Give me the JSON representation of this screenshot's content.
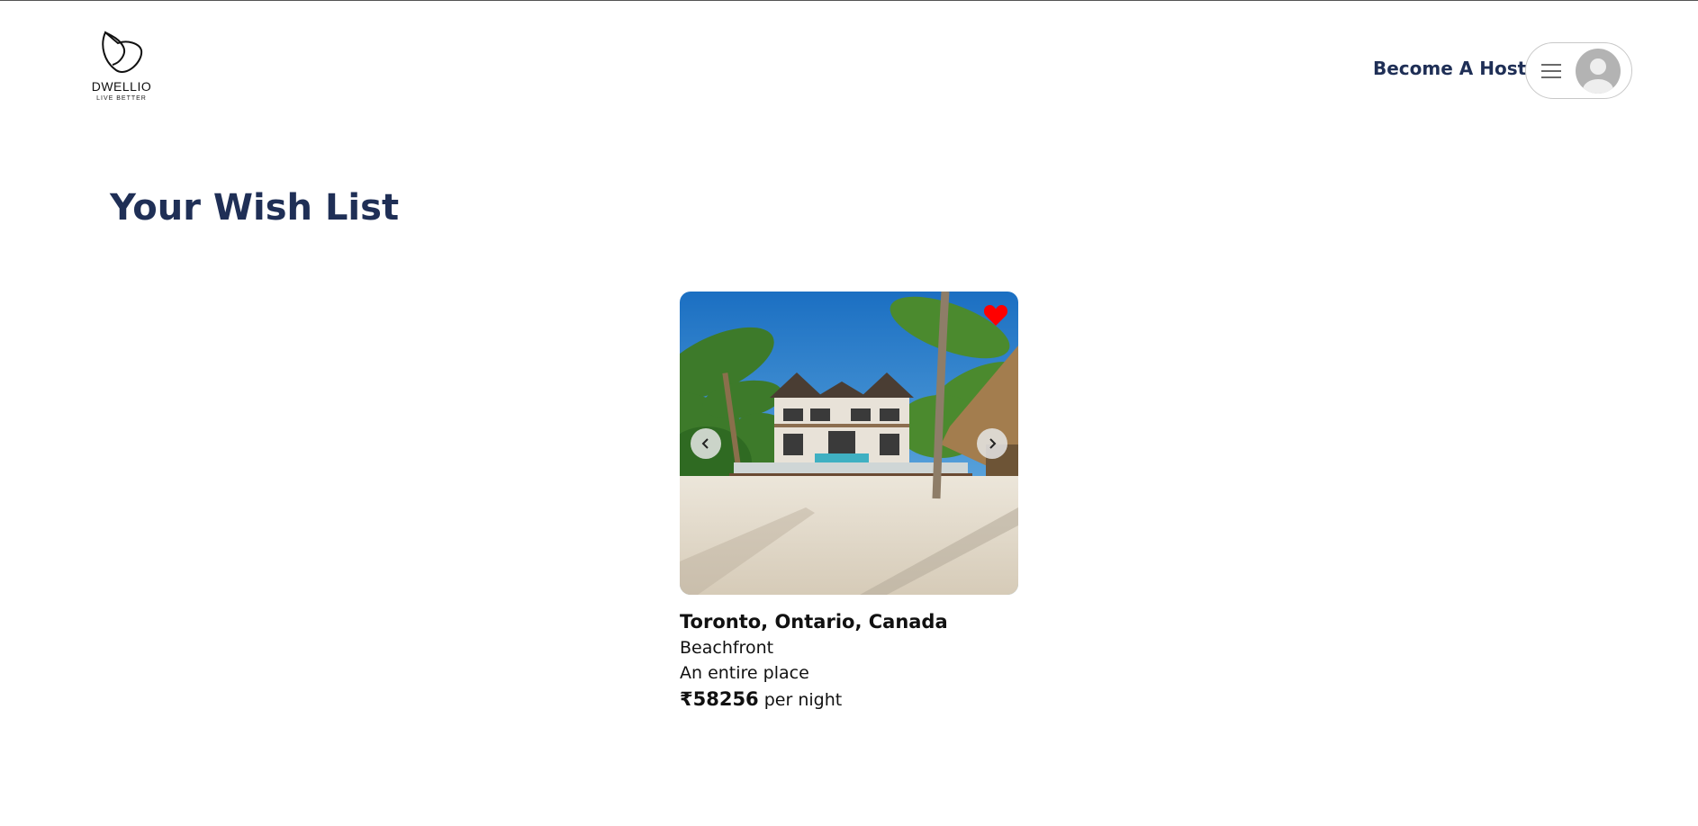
{
  "brand": {
    "name": "DWELLIO",
    "tagline": "LIVE BETTER"
  },
  "header": {
    "become_host": "Become A Host"
  },
  "icons": {
    "menu": "hamburger-icon",
    "avatar": "user-avatar-icon",
    "favorite": "heart-icon",
    "prev": "chevron-left-icon",
    "next": "chevron-right-icon"
  },
  "colors": {
    "title": "#1f2f56",
    "heart": "#ff0000"
  },
  "page": {
    "title": "Your Wish List"
  },
  "wishlist": [
    {
      "location": "Toronto, Ontario, Canada",
      "category": "Beachfront",
      "type": "An entire place",
      "price": "₹58256",
      "price_unit": "per night"
    }
  ]
}
